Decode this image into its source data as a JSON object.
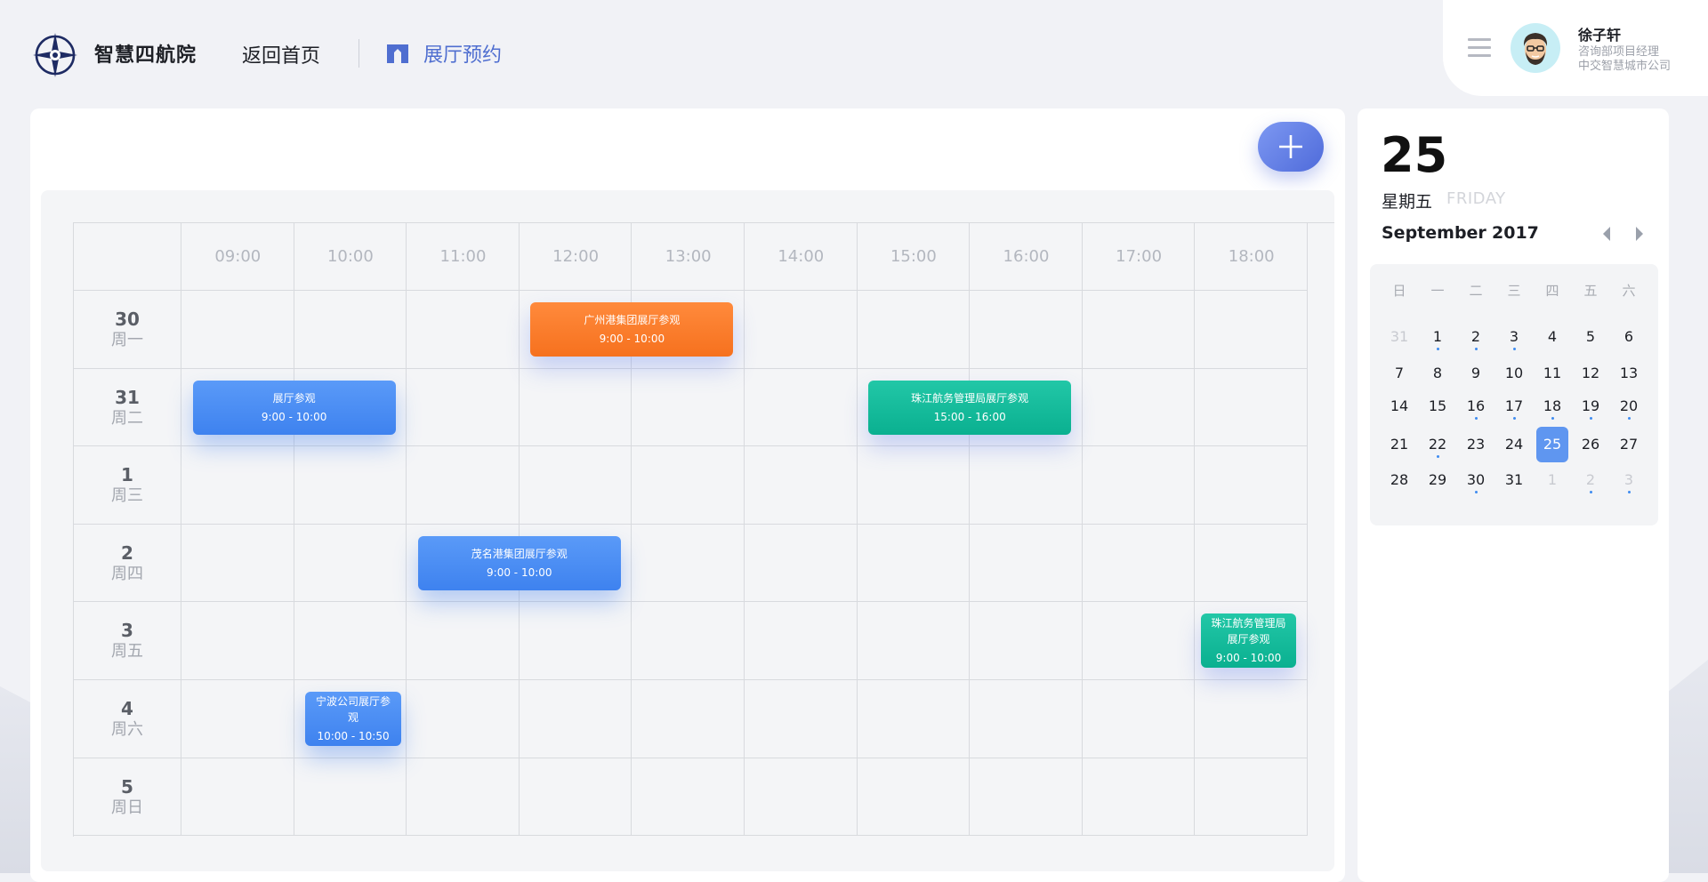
{
  "header": {
    "brand": "智慧四航院",
    "back_label": "返回首页",
    "active_nav": "展厅预约"
  },
  "user": {
    "name": "徐子轩",
    "role": "咨询部项目经理",
    "org": "中交智慧城市公司"
  },
  "schedule": {
    "hours": [
      "09:00",
      "10:00",
      "11:00",
      "12:00",
      "13:00",
      "14:00",
      "15:00",
      "16:00",
      "17:00",
      "18:00"
    ],
    "days": [
      {
        "num": "30",
        "week": "周一"
      },
      {
        "num": "31",
        "week": "周二"
      },
      {
        "num": "1",
        "week": "周三"
      },
      {
        "num": "2",
        "week": "周四"
      },
      {
        "num": "3",
        "week": "周五"
      },
      {
        "num": "4",
        "week": "周六"
      },
      {
        "num": "5",
        "week": "周日"
      }
    ],
    "events": [
      {
        "title": "广州港集团展厅参观",
        "time": "9:00 - 10:00",
        "color": "orange",
        "day": 0,
        "start": 12.1,
        "end": 13.9
      },
      {
        "title": "展厅参观",
        "time": "9:00 - 10:00",
        "color": "blue",
        "day": 1,
        "start": 9.1,
        "end": 10.9
      },
      {
        "title": "珠江航务管理局展厅参观",
        "time": "15:00 - 16:00",
        "color": "green",
        "day": 1,
        "start": 15.1,
        "end": 16.9
      },
      {
        "title": "茂名港集团展厅参观",
        "time": "9:00 - 10:00",
        "color": "blue",
        "day": 3,
        "start": 11.1,
        "end": 12.9
      },
      {
        "title": "珠江航务管理局展厅参观",
        "time": "9:00 - 10:00",
        "color": "green",
        "day": 4,
        "start": 18.05,
        "end": 18.9
      },
      {
        "title": "宁波公司展厅参观",
        "time": "10:00 - 10:50",
        "color": "blue",
        "day": 5,
        "start": 10.1,
        "end": 10.95
      }
    ]
  },
  "calendar": {
    "selected_day": "25",
    "weekday_cn": "星期五",
    "weekday_en": "FRIDAY",
    "month": "September",
    "year": "2017",
    "weekday_headers": [
      "日",
      "一",
      "二",
      "三",
      "四",
      "五",
      "六"
    ],
    "weeks": [
      [
        {
          "d": "31",
          "muted": true
        },
        {
          "d": "1",
          "dot": true
        },
        {
          "d": "2",
          "dot": true
        },
        {
          "d": "3",
          "dot": true
        },
        {
          "d": "4"
        },
        {
          "d": "5"
        },
        {
          "d": "6"
        }
      ],
      [
        {
          "d": "7"
        },
        {
          "d": "8"
        },
        {
          "d": "9"
        },
        {
          "d": "10"
        },
        {
          "d": "11"
        },
        {
          "d": "12"
        },
        {
          "d": "13"
        }
      ],
      [
        {
          "d": "14"
        },
        {
          "d": "15"
        },
        {
          "d": "16",
          "dot": true
        },
        {
          "d": "17",
          "dot": true
        },
        {
          "d": "18",
          "dot": true
        },
        {
          "d": "19",
          "dot": true
        },
        {
          "d": "20",
          "dot": true
        }
      ],
      [
        {
          "d": "21"
        },
        {
          "d": "22",
          "dot": true
        },
        {
          "d": "23"
        },
        {
          "d": "24"
        },
        {
          "d": "25",
          "selected": true
        },
        {
          "d": "26"
        },
        {
          "d": "27"
        }
      ],
      [
        {
          "d": "28"
        },
        {
          "d": "29"
        },
        {
          "d": "30",
          "dot": true
        },
        {
          "d": "31"
        },
        {
          "d": "1",
          "muted": true
        },
        {
          "d": "2",
          "muted": true,
          "dot": true
        },
        {
          "d": "3",
          "muted": true,
          "dot": true
        }
      ]
    ]
  }
}
